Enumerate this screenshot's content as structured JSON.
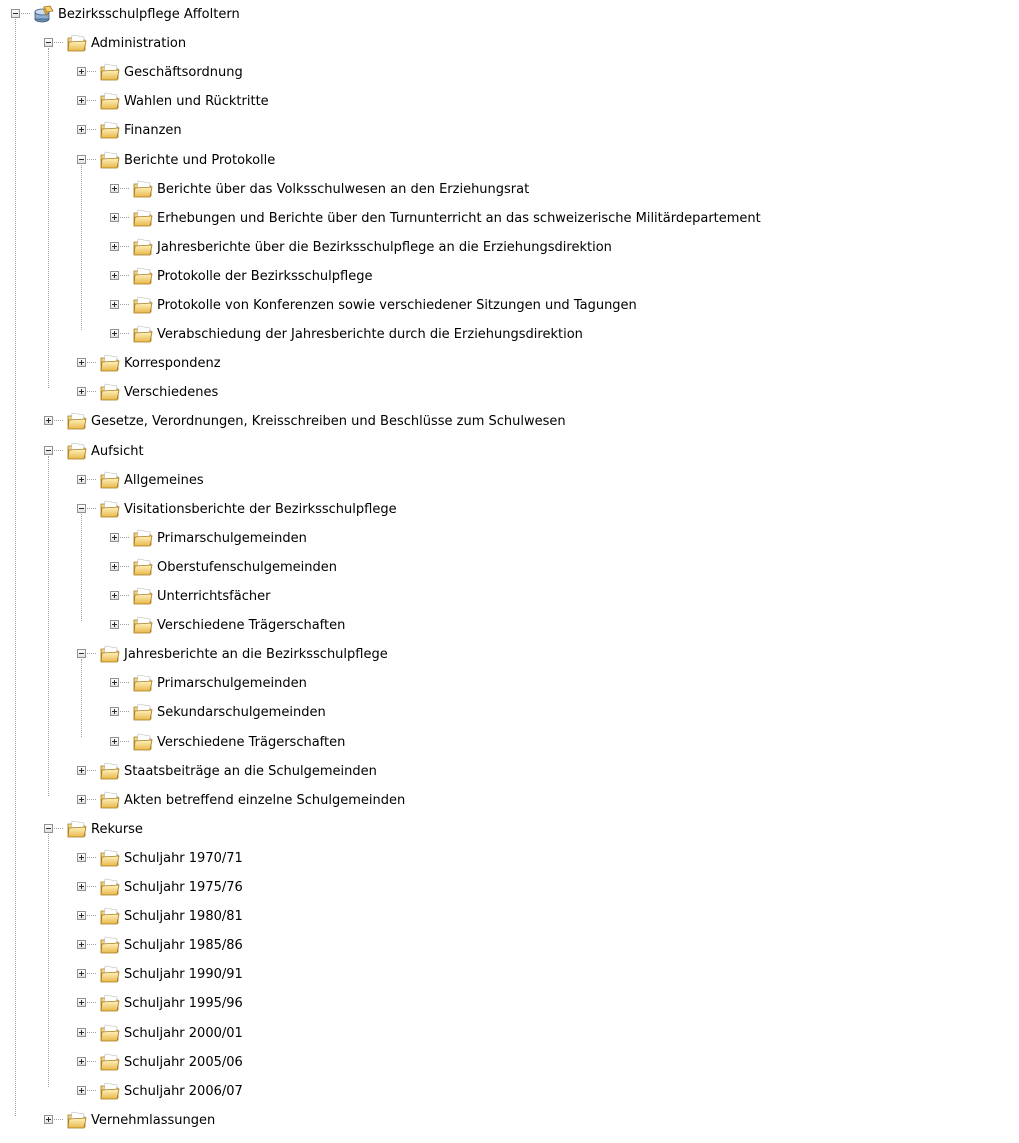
{
  "tree": {
    "nodes": [
      {
        "label": "Bezirksschulpflege Affoltern",
        "level": 0,
        "expanded": true,
        "icon": "archive-database-icon"
      },
      {
        "label": "Administration",
        "level": 1,
        "expanded": true,
        "icon": "folder-icon"
      },
      {
        "label": "Geschäftsordnung",
        "level": 2,
        "expanded": false,
        "icon": "folder-icon"
      },
      {
        "label": "Wahlen und Rücktritte",
        "level": 2,
        "expanded": false,
        "icon": "folder-icon"
      },
      {
        "label": "Finanzen",
        "level": 2,
        "expanded": false,
        "icon": "folder-icon"
      },
      {
        "label": "Berichte und Protokolle",
        "level": 2,
        "expanded": true,
        "icon": "folder-icon"
      },
      {
        "label": "Berichte über das Volksschulwesen an den Erziehungsrat",
        "level": 3,
        "expanded": false,
        "icon": "folder-icon"
      },
      {
        "label": "Erhebungen und Berichte über den Turnunterricht an das schweizerische Militärdepartement",
        "level": 3,
        "expanded": false,
        "icon": "folder-icon"
      },
      {
        "label": "Jahresberichte über die Bezirksschulpflege an die Erziehungsdirektion",
        "level": 3,
        "expanded": false,
        "icon": "folder-icon"
      },
      {
        "label": "Protokolle der Bezirksschulpflege",
        "level": 3,
        "expanded": false,
        "icon": "folder-icon"
      },
      {
        "label": "Protokolle von Konferenzen sowie verschiedener Sitzungen und Tagungen",
        "level": 3,
        "expanded": false,
        "icon": "folder-icon"
      },
      {
        "label": "Verabschiedung der Jahresberichte durch die Erziehungsdirektion",
        "level": 3,
        "expanded": false,
        "icon": "folder-icon"
      },
      {
        "label": "Korrespondenz",
        "level": 2,
        "expanded": false,
        "icon": "folder-icon"
      },
      {
        "label": "Verschiedenes",
        "level": 2,
        "expanded": false,
        "icon": "folder-icon"
      },
      {
        "label": "Gesetze, Verordnungen, Kreisschreiben und Beschlüsse zum Schulwesen",
        "level": 1,
        "expanded": false,
        "icon": "folder-icon"
      },
      {
        "label": "Aufsicht",
        "level": 1,
        "expanded": true,
        "icon": "folder-icon"
      },
      {
        "label": "Allgemeines",
        "level": 2,
        "expanded": false,
        "icon": "folder-icon"
      },
      {
        "label": "Visitationsberichte der Bezirksschulpflege",
        "level": 2,
        "expanded": true,
        "icon": "folder-icon"
      },
      {
        "label": "Primarschulgemeinden",
        "level": 3,
        "expanded": false,
        "icon": "folder-icon"
      },
      {
        "label": "Oberstufenschulgemeinden",
        "level": 3,
        "expanded": false,
        "icon": "folder-icon"
      },
      {
        "label": "Unterrichtsfächer",
        "level": 3,
        "expanded": false,
        "icon": "folder-icon"
      },
      {
        "label": "Verschiedene Trägerschaften",
        "level": 3,
        "expanded": false,
        "icon": "folder-icon"
      },
      {
        "label": "Jahresberichte an die Bezirksschulpflege",
        "level": 2,
        "expanded": true,
        "icon": "folder-icon"
      },
      {
        "label": "Primarschulgemeinden",
        "level": 3,
        "expanded": false,
        "icon": "folder-icon"
      },
      {
        "label": "Sekundarschulgemeinden",
        "level": 3,
        "expanded": false,
        "icon": "folder-icon"
      },
      {
        "label": "Verschiedene Trägerschaften",
        "level": 3,
        "expanded": false,
        "icon": "folder-icon"
      },
      {
        "label": "Staatsbeiträge an die Schulgemeinden",
        "level": 2,
        "expanded": false,
        "icon": "folder-icon"
      },
      {
        "label": "Akten betreffend einzelne Schulgemeinden",
        "level": 2,
        "expanded": false,
        "icon": "folder-icon"
      },
      {
        "label": "Rekurse",
        "level": 1,
        "expanded": true,
        "icon": "folder-icon"
      },
      {
        "label": "Schuljahr 1970/71",
        "level": 2,
        "expanded": false,
        "icon": "folder-icon"
      },
      {
        "label": "Schuljahr 1975/76",
        "level": 2,
        "expanded": false,
        "icon": "folder-icon"
      },
      {
        "label": "Schuljahr 1980/81",
        "level": 2,
        "expanded": false,
        "icon": "folder-icon"
      },
      {
        "label": "Schuljahr 1985/86",
        "level": 2,
        "expanded": false,
        "icon": "folder-icon"
      },
      {
        "label": "Schuljahr 1990/91",
        "level": 2,
        "expanded": false,
        "icon": "folder-icon"
      },
      {
        "label": "Schuljahr 1995/96",
        "level": 2,
        "expanded": false,
        "icon": "folder-icon"
      },
      {
        "label": "Schuljahr 2000/01",
        "level": 2,
        "expanded": false,
        "icon": "folder-icon"
      },
      {
        "label": "Schuljahr 2005/06",
        "level": 2,
        "expanded": false,
        "icon": "folder-icon"
      },
      {
        "label": "Schuljahr 2006/07",
        "level": 2,
        "expanded": false,
        "icon": "folder-icon"
      },
      {
        "label": "Vernehmlassungen",
        "level": 1,
        "expanded": false,
        "icon": "folder-icon"
      }
    ]
  }
}
